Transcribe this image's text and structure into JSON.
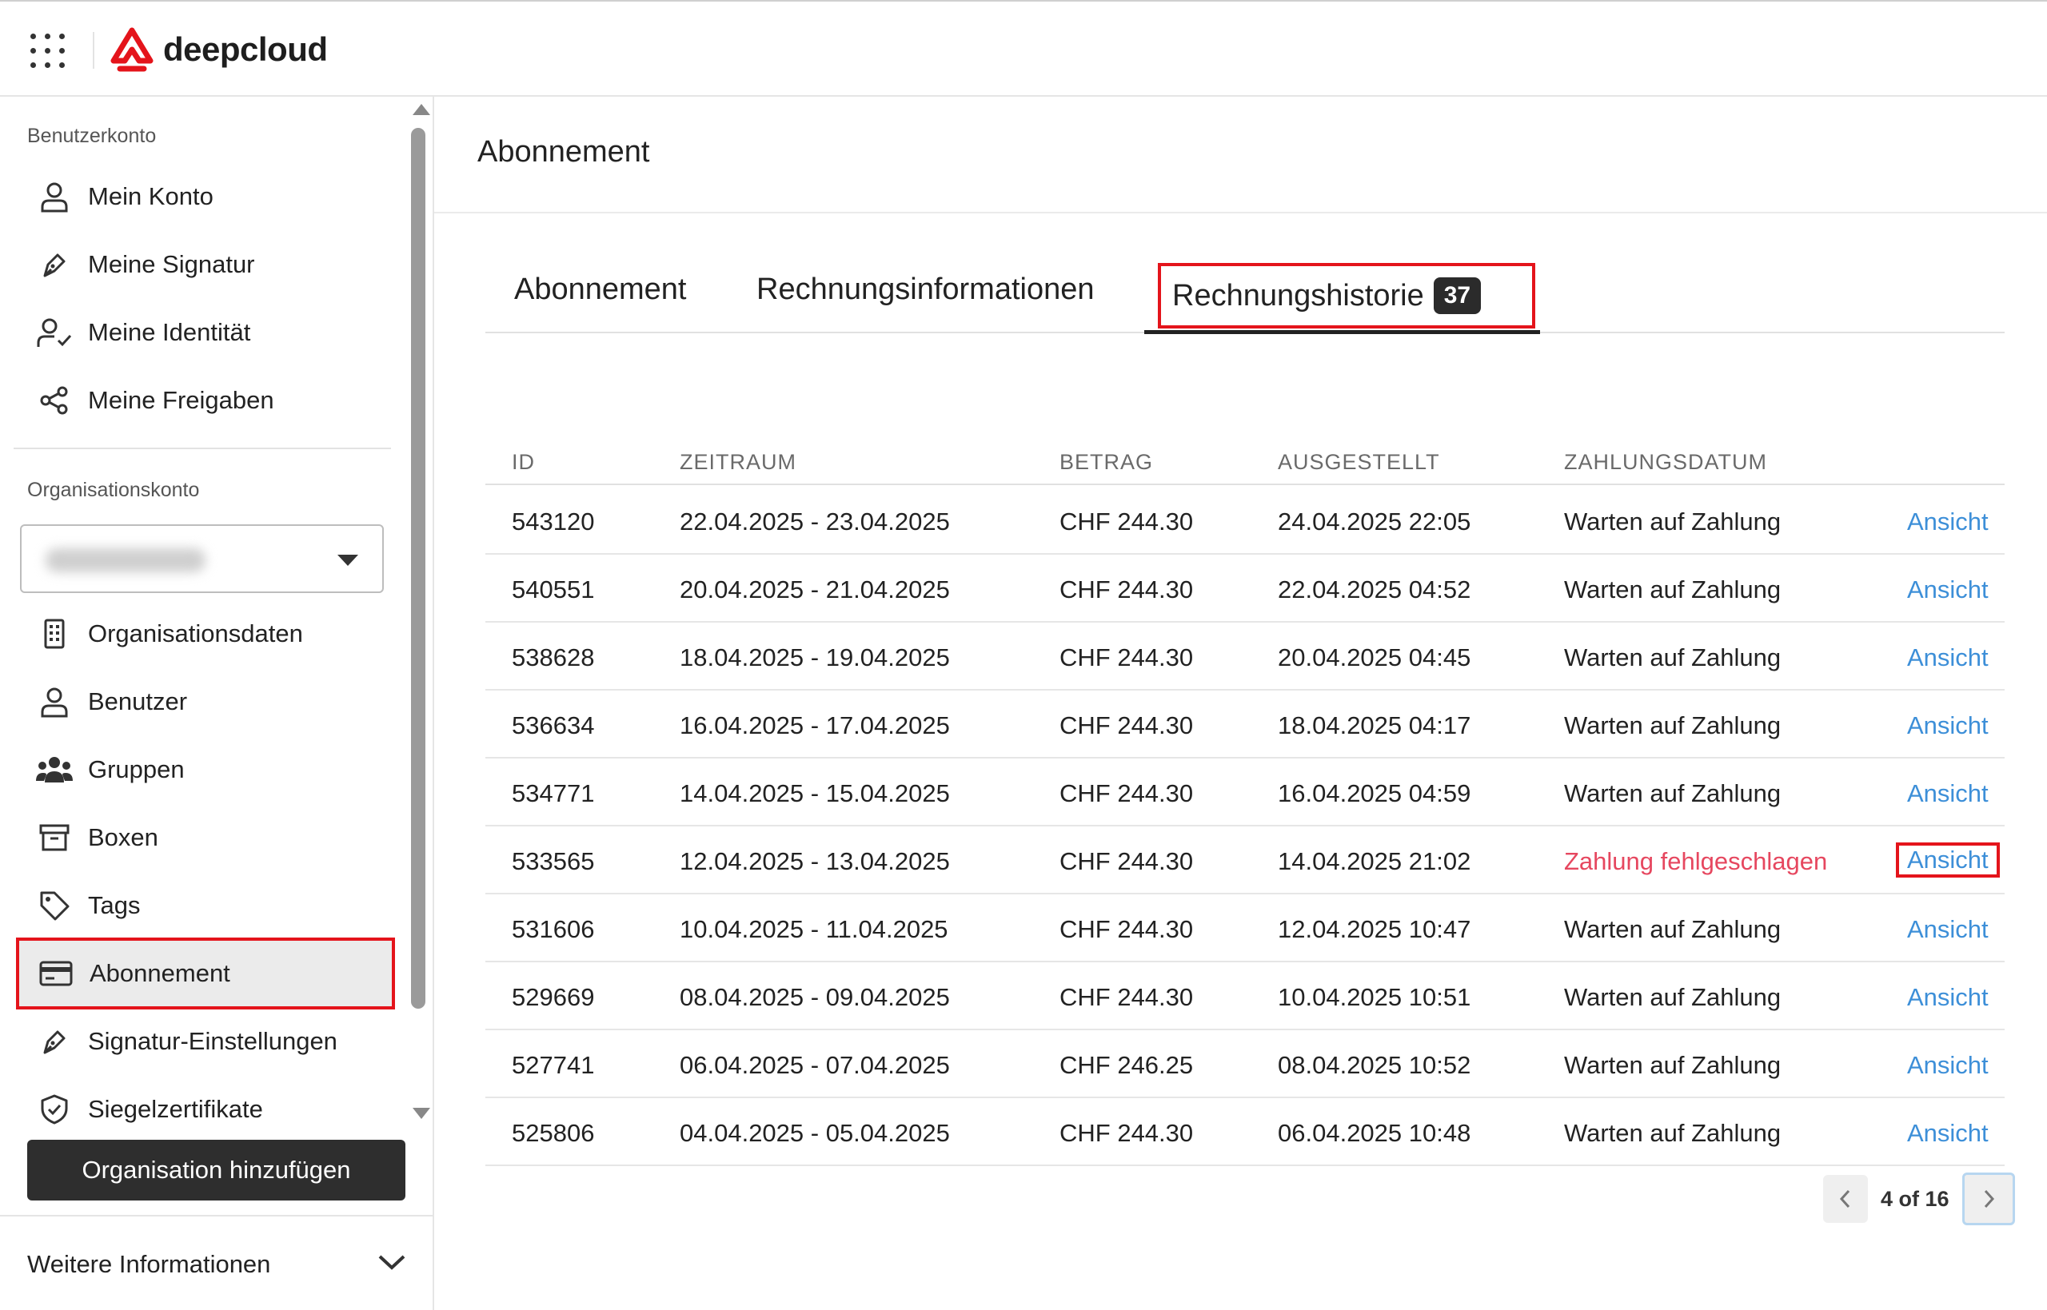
{
  "app": {
    "brand": "deepcloud"
  },
  "sidebar": {
    "section_user": "Benutzerkonto",
    "user_items": [
      {
        "label": "Mein Konto",
        "icon": "user-icon"
      },
      {
        "label": "Meine Signatur",
        "icon": "pen-icon"
      },
      {
        "label": "Meine Identität",
        "icon": "user-check-icon"
      },
      {
        "label": "Meine Freigaben",
        "icon": "share-icon"
      }
    ],
    "section_org": "Organisationskonto",
    "org_items": [
      {
        "label": "Organisationsdaten",
        "icon": "building-icon"
      },
      {
        "label": "Benutzer",
        "icon": "user-icon"
      },
      {
        "label": "Gruppen",
        "icon": "group-icon"
      },
      {
        "label": "Boxen",
        "icon": "archive-box-icon"
      },
      {
        "label": "Tags",
        "icon": "tag-icon"
      },
      {
        "label": "Abonnement",
        "icon": "credit-card-icon",
        "active": true
      },
      {
        "label": "Signatur-Einstellungen",
        "icon": "pen-icon"
      },
      {
        "label": "Siegelzertifikate",
        "icon": "shield-check-icon"
      }
    ],
    "add_org_button": "Organisation hinzufügen",
    "more_info": "Weitere Informationen"
  },
  "main": {
    "title": "Abonnement",
    "tabs": [
      {
        "label": "Abonnement"
      },
      {
        "label": "Rechnungsinformationen"
      },
      {
        "label": "Rechnungshistorie",
        "badge": "37",
        "active": true
      }
    ],
    "table": {
      "headers": [
        "ID",
        "ZEITRAUM",
        "BETRAG",
        "AUSGESTELLT",
        "ZAHLUNGSDATUM"
      ],
      "rows": [
        {
          "id": "543120",
          "zeitraum": "22.04.2025 - 23.04.2025",
          "betrag": "CHF 244.30",
          "ausgestellt": "24.04.2025 22:05",
          "status": "Warten auf Zahlung",
          "link": "Ansicht"
        },
        {
          "id": "540551",
          "zeitraum": "20.04.2025 - 21.04.2025",
          "betrag": "CHF 244.30",
          "ausgestellt": "22.04.2025 04:52",
          "status": "Warten auf Zahlung",
          "link": "Ansicht"
        },
        {
          "id": "538628",
          "zeitraum": "18.04.2025 - 19.04.2025",
          "betrag": "CHF 244.30",
          "ausgestellt": "20.04.2025 04:45",
          "status": "Warten auf Zahlung",
          "link": "Ansicht"
        },
        {
          "id": "536634",
          "zeitraum": "16.04.2025 - 17.04.2025",
          "betrag": "CHF 244.30",
          "ausgestellt": "18.04.2025 04:17",
          "status": "Warten auf Zahlung",
          "link": "Ansicht"
        },
        {
          "id": "534771",
          "zeitraum": "14.04.2025 - 15.04.2025",
          "betrag": "CHF 244.30",
          "ausgestellt": "16.04.2025 04:59",
          "status": "Warten auf Zahlung",
          "link": "Ansicht"
        },
        {
          "id": "533565",
          "zeitraum": "12.04.2025 - 13.04.2025",
          "betrag": "CHF 244.30",
          "ausgestellt": "14.04.2025 21:02",
          "status": "Zahlung fehlgeschlagen",
          "link": "Ansicht",
          "failed": true
        },
        {
          "id": "531606",
          "zeitraum": "10.04.2025 - 11.04.2025",
          "betrag": "CHF 244.30",
          "ausgestellt": "12.04.2025 10:47",
          "status": "Warten auf Zahlung",
          "link": "Ansicht"
        },
        {
          "id": "529669",
          "zeitraum": "08.04.2025 - 09.04.2025",
          "betrag": "CHF 244.30",
          "ausgestellt": "10.04.2025 10:51",
          "status": "Warten auf Zahlung",
          "link": "Ansicht"
        },
        {
          "id": "527741",
          "zeitraum": "06.04.2025 - 07.04.2025",
          "betrag": "CHF 246.25",
          "ausgestellt": "08.04.2025 10:52",
          "status": "Warten auf Zahlung",
          "link": "Ansicht"
        },
        {
          "id": "525806",
          "zeitraum": "04.04.2025 - 05.04.2025",
          "betrag": "CHF 244.30",
          "ausgestellt": "06.04.2025 10:48",
          "status": "Warten auf Zahlung",
          "link": "Ansicht"
        }
      ]
    },
    "pagination": {
      "text": "4 of 16"
    }
  },
  "colors": {
    "accent_red": "#e4141b",
    "link_blue": "#3d8fd8",
    "fail_red": "#e6475f",
    "dark_button": "#2e2e2e"
  }
}
